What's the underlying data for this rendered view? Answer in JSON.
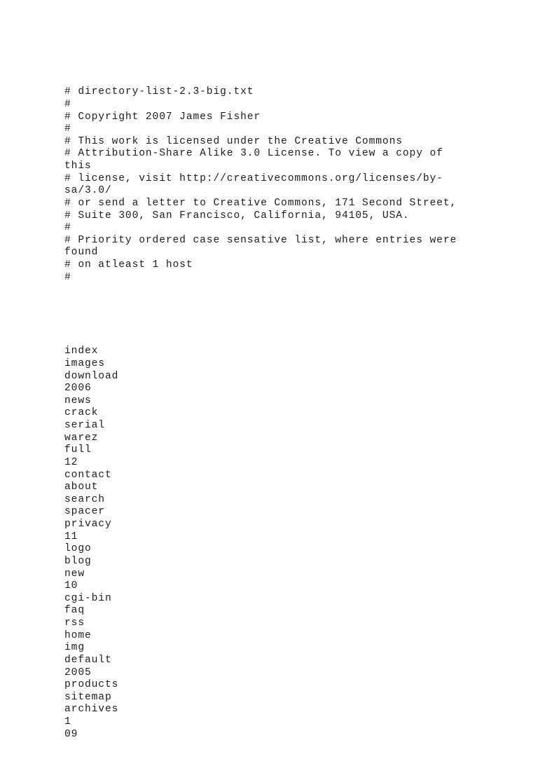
{
  "document": {
    "kind": "plain-text-file",
    "filename": "directory-list-2.3-big.txt",
    "text_color": "#1c1c1c",
    "background_color": "#ffffff",
    "header_comment_lines": [
      "# directory-list-2.3-big.txt",
      "#",
      "# Copyright 2007 James Fisher",
      "#",
      "# This work is licensed under the Creative Commons",
      "# Attribution-Share Alike 3.0 License. To view a copy of this",
      "# license, visit http://creativecommons.org/licenses/by-sa/3.0/",
      "# or send a letter to Creative Commons, 171 Second Street,",
      "# Suite 300, San Francisco, California, 94105, USA.",
      "#",
      "# Priority ordered case sensative list, where entries were found",
      "# on atleast 1 host",
      "#"
    ],
    "blank_separator": "",
    "entries": [
      "index",
      "images",
      "download",
      "2006",
      "news",
      "crack",
      "serial",
      "warez",
      "full",
      "12",
      "contact",
      "about",
      "search",
      "spacer",
      "privacy",
      "11",
      "logo",
      "blog",
      "new",
      "10",
      "cgi-bin",
      "faq",
      "rss",
      "home",
      "img",
      "default",
      "2005",
      "products",
      "sitemap",
      "archives",
      "1",
      "09"
    ]
  }
}
